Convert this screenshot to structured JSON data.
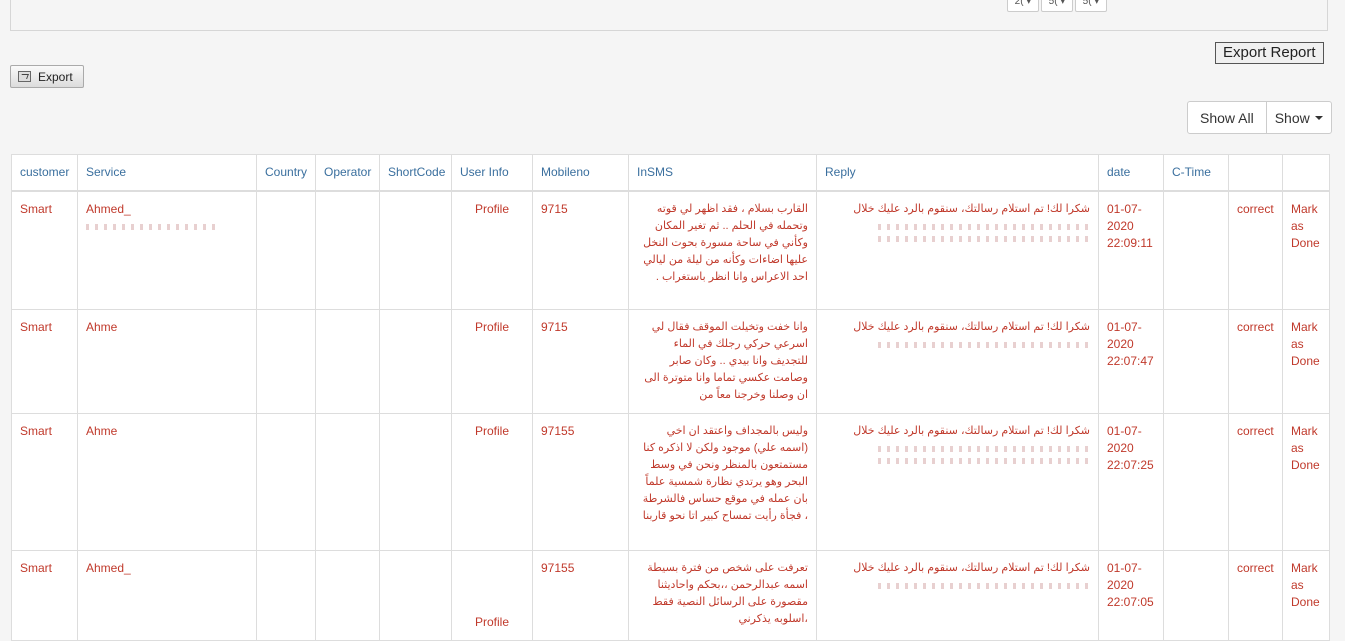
{
  "time_selects": [
    "2( ▾",
    "5( ▾",
    "5( ▾"
  ],
  "export_report_label": "Export Report",
  "export_label": "Export",
  "show_all_label": "Show All",
  "show_label": "Show",
  "columns": [
    "customer",
    "Service",
    "Country",
    "Operator",
    "ShortCode",
    "User Info",
    "Mobileno",
    "InSMS",
    "Reply",
    "date",
    "C-Time",
    "",
    ""
  ],
  "rows": [
    {
      "customer": "Smart",
      "service": "Ahmed_",
      "country": "",
      "operator": "",
      "shortcode": "",
      "user_info": "Profile",
      "mobile": "9715",
      "insms": "القارب بسلام ، فقد اظهر لي قوته وتحمله في الحلم .. ثم تغير المكان وكأني في ساحة مسورة بحوت النخل عليها اضاءات وكأنه من ليلة من ليالي احد الاعراس وانا انظر باستغراب .",
      "reply": "شكرا لك! تم استلام رسالتك، سنقوم بالرد عليك خلال",
      "date": "01-07-2020 22:09:11",
      "ctime": "",
      "status": "correct",
      "action": "Mark as Done"
    },
    {
      "customer": "Smart",
      "service": "Ahme",
      "country": "",
      "operator": "",
      "shortcode": "",
      "user_info": "Profile",
      "mobile": "9715",
      "insms": "وانا خفت وتخيلت الموقف فقال لي اسرعي حركي رجلك في الماء للتجديف وانا بيدي .. وكان صابر وصامت عكسي تماما وانا متوترة الى ان وصلنا وخرجنا معاً من",
      "reply": "شكرا لك! تم استلام رسالتك، سنقوم بالرد عليك خلال",
      "date": "01-07-2020 22:07:47",
      "ctime": "",
      "status": "correct",
      "action": "Mark as Done"
    },
    {
      "customer": "Smart",
      "service": "Ahme",
      "country": "",
      "operator": "",
      "shortcode": "",
      "user_info": "Profile",
      "mobile": "97155",
      "insms": "وليس بالمجداف واعتقد ان اخي (اسمه علي) موجود ولكن لا اذكره كنا مستمتعون بالمنظر ونحن في وسط البحر وهو يرتدي نظارة شمسية علماً بان عمله في موقع حساس فالشرطة ، فجأة رأيت تمساح كبير اتا نحو قاربنا",
      "reply": "شكرا لك! تم استلام رسالتك، سنقوم بالرد عليك خلال",
      "date": "01-07-2020 22:07:25",
      "ctime": "",
      "status": "correct",
      "action": "Mark as Done"
    },
    {
      "customer": "Smart",
      "service": "Ahmed_",
      "country": "",
      "operator": "",
      "shortcode": "",
      "user_info": "Profile",
      "mobile": "97155",
      "insms": "تعرفت على شخص من فترة بسيطة اسمه عبدالرحمن ،،بحكم واحاديثنا مقصورة على الرسائل النصية فقط ،اسلوبه يذكرني",
      "reply": "شكرا لك! تم استلام رسالتك، سنقوم بالرد عليك خلال",
      "date": "01-07-2020 22:07:05",
      "ctime": "",
      "status": "correct",
      "action": "Mark as Done"
    }
  ]
}
